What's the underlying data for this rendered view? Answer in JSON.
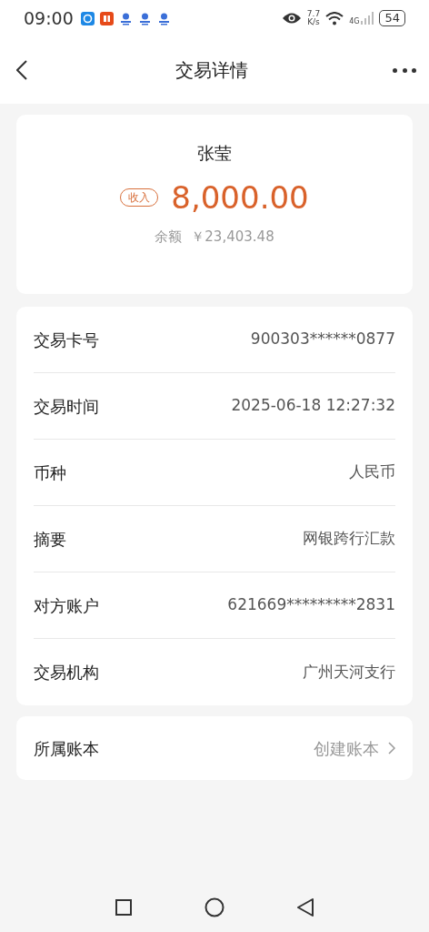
{
  "status_bar": {
    "time": "09:00",
    "speed_value": "7.7",
    "speed_unit": "K/s",
    "network": "4G",
    "battery": "54"
  },
  "header": {
    "title": "交易详情"
  },
  "summary": {
    "name": "张莹",
    "badge": "收入",
    "amount": "8,000.00",
    "balance_label": "余额",
    "balance": "￥23,403.48"
  },
  "details": [
    {
      "label": "交易卡号",
      "value": "900303******0877"
    },
    {
      "label": "交易时间",
      "value": "2025-06-18 12:27:32"
    },
    {
      "label": "币种",
      "value": "人民币"
    },
    {
      "label": "摘要",
      "value": "网银跨行汇款"
    },
    {
      "label": "对方账户",
      "value": "621669*********2831"
    },
    {
      "label": "交易机构",
      "value": "广州天河支行"
    }
  ],
  "ledger": {
    "label": "所属账本",
    "value": "创建账本"
  }
}
